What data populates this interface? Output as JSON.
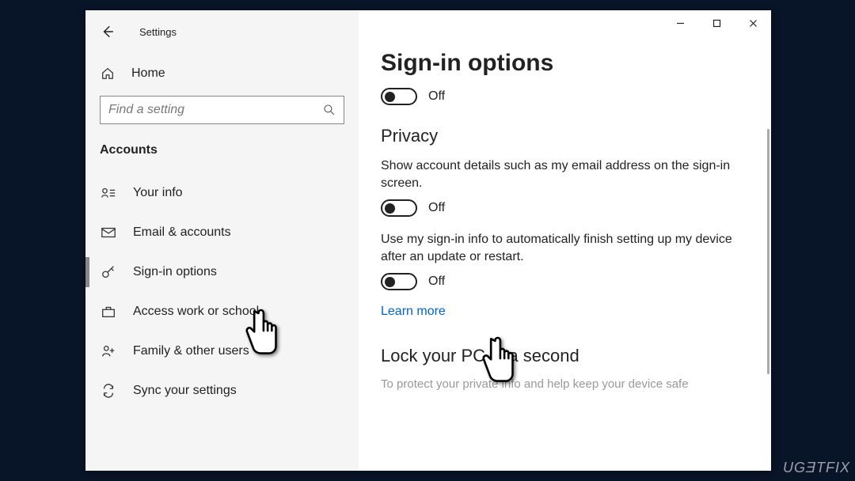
{
  "app_title": "Settings",
  "home_label": "Home",
  "search_placeholder": "Find a setting",
  "section": "Accounts",
  "nav": [
    {
      "icon": "user-card-icon",
      "label": "Your info"
    },
    {
      "icon": "mail-icon",
      "label": "Email & accounts"
    },
    {
      "icon": "key-icon",
      "label": "Sign-in options"
    },
    {
      "icon": "briefcase-icon",
      "label": "Access work or school"
    },
    {
      "icon": "family-icon",
      "label": "Family & other users"
    },
    {
      "icon": "sync-icon",
      "label": "Sync your settings"
    }
  ],
  "selected_nav_index": 2,
  "page": {
    "title": "Sign-in options",
    "top_toggle_state": "Off",
    "privacy_title": "Privacy",
    "privacy_desc1": "Show account details such as my email address on the sign-in screen.",
    "privacy_toggle1_state": "Off",
    "privacy_desc2": "Use my sign-in info to automatically finish setting up my device after an update or restart.",
    "privacy_toggle2_state": "Off",
    "learn_more": "Learn more",
    "lock_title": "Lock your PC in a second",
    "lock_desc": "To protect your private info and help keep your device safe"
  },
  "watermark": "UGƎTFIX"
}
